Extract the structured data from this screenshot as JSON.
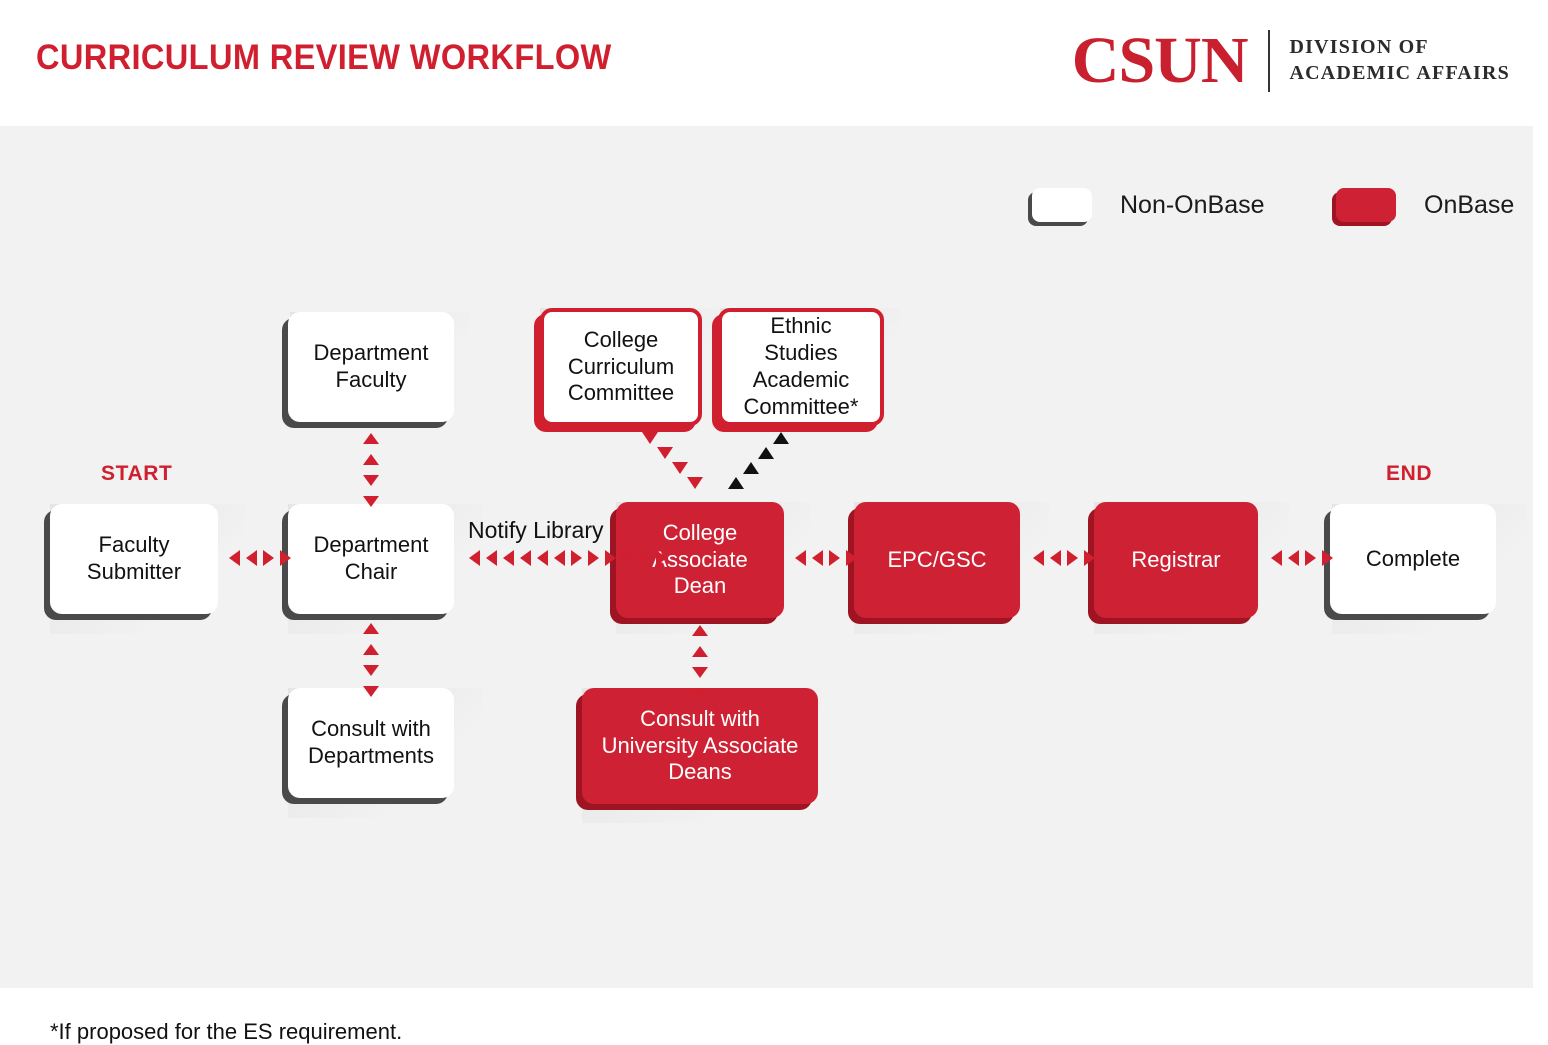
{
  "header": {
    "title": "CURRICULUM REVIEW WORKFLOW",
    "logo": {
      "wordmark": "CSUN",
      "subtitle_line1": "DIVISION OF",
      "subtitle_line2": "ACADEMIC AFFAIRS"
    }
  },
  "legend": {
    "items": [
      {
        "label": "Non-OnBase",
        "style": "white",
        "color": "#FFFFFF"
      },
      {
        "label": "OnBase",
        "style": "red",
        "color": "#CE2234"
      }
    ]
  },
  "markers": {
    "start": "START",
    "end": "END"
  },
  "edge_labels": {
    "notify_library": "Notify Library"
  },
  "nodes": [
    {
      "id": "department-faculty",
      "label_line1": "Department",
      "label_line2": "Faculty",
      "style": "white"
    },
    {
      "id": "college-curriculum-committee",
      "label_line1": "College",
      "label_line2": "Curriculum",
      "label_line3": "Committee",
      "style": "redline"
    },
    {
      "id": "ethnic-studies-academic-committee",
      "label_line1": "Ethnic Studies",
      "label_line2": "Academic",
      "label_line3": "Committee*",
      "style": "redline"
    },
    {
      "id": "faculty-submitter",
      "label_line1": "Faculty",
      "label_line2": "Submitter",
      "style": "white"
    },
    {
      "id": "department-chair",
      "label_line1": "Department",
      "label_line2": "Chair",
      "style": "white"
    },
    {
      "id": "college-associate-dean",
      "label_line1": "College",
      "label_line2": "Associate",
      "label_line3": "Dean",
      "style": "red"
    },
    {
      "id": "epc-gsc",
      "label_line1": "EPC/GSC",
      "style": "red"
    },
    {
      "id": "registrar",
      "label_line1": "Registrar",
      "style": "red"
    },
    {
      "id": "complete",
      "label_line1": "Complete",
      "style": "white"
    },
    {
      "id": "consult-with-departments",
      "label_line1": "Consult with",
      "label_line2": "Departments",
      "style": "white"
    },
    {
      "id": "consult-with-university-associate-deans",
      "label_line1": "Consult with",
      "label_line2": "University Associate",
      "label_line3": "Deans",
      "style": "red"
    }
  ],
  "footnote": "*If proposed for the ES requirement.",
  "colors": {
    "brand_red": "#D0202F",
    "node_red": "#CE2234",
    "shadow_red": "#9E1423",
    "shadow_gray": "#4A4A4A",
    "canvas_bg": "#F2F2F2"
  }
}
